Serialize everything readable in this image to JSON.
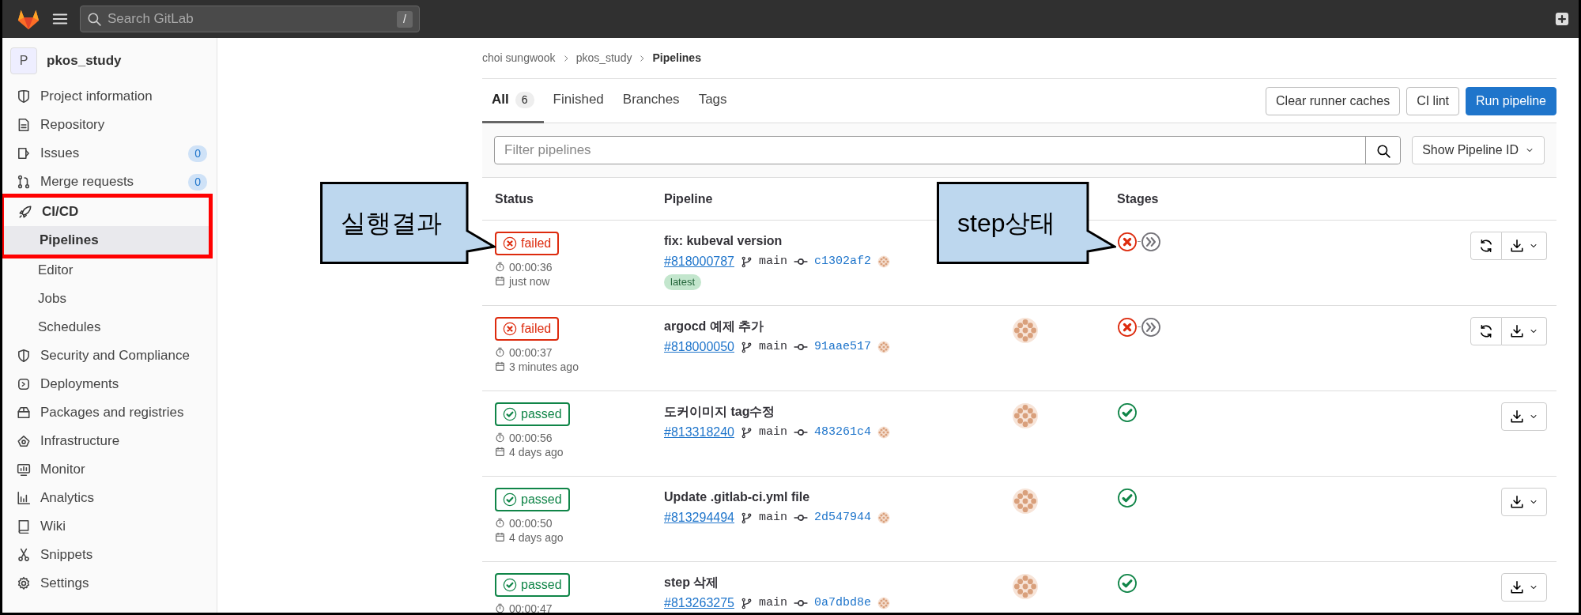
{
  "topbar": {
    "search_placeholder": "Search GitLab",
    "search_shortcut": "/"
  },
  "sidebar": {
    "project_initial": "P",
    "project_name": "pkos_study",
    "items": [
      {
        "label": "Project information"
      },
      {
        "label": "Repository"
      },
      {
        "label": "Issues",
        "count": "0"
      },
      {
        "label": "Merge requests",
        "count": "0"
      },
      {
        "label": "CI/CD",
        "highlighted": true,
        "children": [
          {
            "label": "Pipelines",
            "selected": true
          },
          {
            "label": "Editor",
            "selected": false
          },
          {
            "label": "Jobs",
            "selected": false
          },
          {
            "label": "Schedules",
            "selected": false
          }
        ]
      },
      {
        "label": "Security and Compliance"
      },
      {
        "label": "Deployments"
      },
      {
        "label": "Packages and registries"
      },
      {
        "label": "Infrastructure"
      },
      {
        "label": "Monitor"
      },
      {
        "label": "Analytics"
      },
      {
        "label": "Wiki"
      },
      {
        "label": "Snippets"
      },
      {
        "label": "Settings"
      }
    ]
  },
  "breadcrumb": [
    "choi sungwook",
    "pkos_study",
    "Pipelines"
  ],
  "tabs": [
    {
      "label": "All",
      "count": "6",
      "selected": true
    },
    {
      "label": "Finished",
      "selected": false
    },
    {
      "label": "Branches",
      "selected": false
    },
    {
      "label": "Tags",
      "selected": false
    }
  ],
  "buttons": [
    {
      "label": "Clear runner caches",
      "kind": "default"
    },
    {
      "label": "CI lint",
      "kind": "default"
    },
    {
      "label": "Run pipeline",
      "kind": "primary"
    }
  ],
  "filter": {
    "placeholder": "Filter pipelines",
    "display_dropdown": "Show Pipeline ID"
  },
  "table": {
    "columns": {
      "status": "Status",
      "pipeline": "Pipeline",
      "stages": "Stages"
    },
    "rows": [
      {
        "kind": "failed",
        "status_label": "failed",
        "duration": "00:00:36",
        "finished": "just now",
        "title": "fix: kubeval version",
        "id": "#818000787",
        "branch": "main",
        "commit": "c1302af2",
        "badges": [
          "latest"
        ],
        "triggerer_avatar": false,
        "stages": [
          {
            "kind": "failed"
          },
          {
            "kind": "skipped"
          }
        ],
        "retry": true
      },
      {
        "kind": "failed",
        "status_label": "failed",
        "duration": "00:00:37",
        "finished": "3 minutes ago",
        "title": "argocd 예제 추가",
        "id": "#818000050",
        "branch": "main",
        "commit": "91aae517",
        "badges": [],
        "triggerer_avatar": true,
        "stages": [
          {
            "kind": "failed"
          },
          {
            "kind": "skipped"
          }
        ],
        "retry": true
      },
      {
        "kind": "passed",
        "status_label": "passed",
        "duration": "00:00:56",
        "finished": "4 days ago",
        "title": "도커이미지 tag수정",
        "id": "#813318240",
        "branch": "main",
        "commit": "483261c4",
        "badges": [],
        "triggerer_avatar": true,
        "stages": [
          {
            "kind": "passed"
          }
        ],
        "retry": false
      },
      {
        "kind": "passed",
        "status_label": "passed",
        "duration": "00:00:50",
        "finished": "4 days ago",
        "title": "Update .gitlab-ci.yml file",
        "id": "#813294494",
        "branch": "main",
        "commit": "2d547944",
        "badges": [],
        "triggerer_avatar": true,
        "stages": [
          {
            "kind": "passed"
          }
        ],
        "retry": false
      },
      {
        "kind": "passed",
        "status_label": "passed",
        "duration": "00:00:47",
        "title": "step 삭제",
        "id": "#813263275",
        "branch": "main",
        "commit": "0a7dbd8e",
        "badges": [],
        "triggerer_avatar": true,
        "stages": [
          {
            "kind": "passed"
          }
        ],
        "retry": false
      }
    ]
  },
  "annotations": [
    {
      "text": "실행결과",
      "kind": "status"
    },
    {
      "text": "step상태",
      "kind": "stages"
    }
  ]
}
